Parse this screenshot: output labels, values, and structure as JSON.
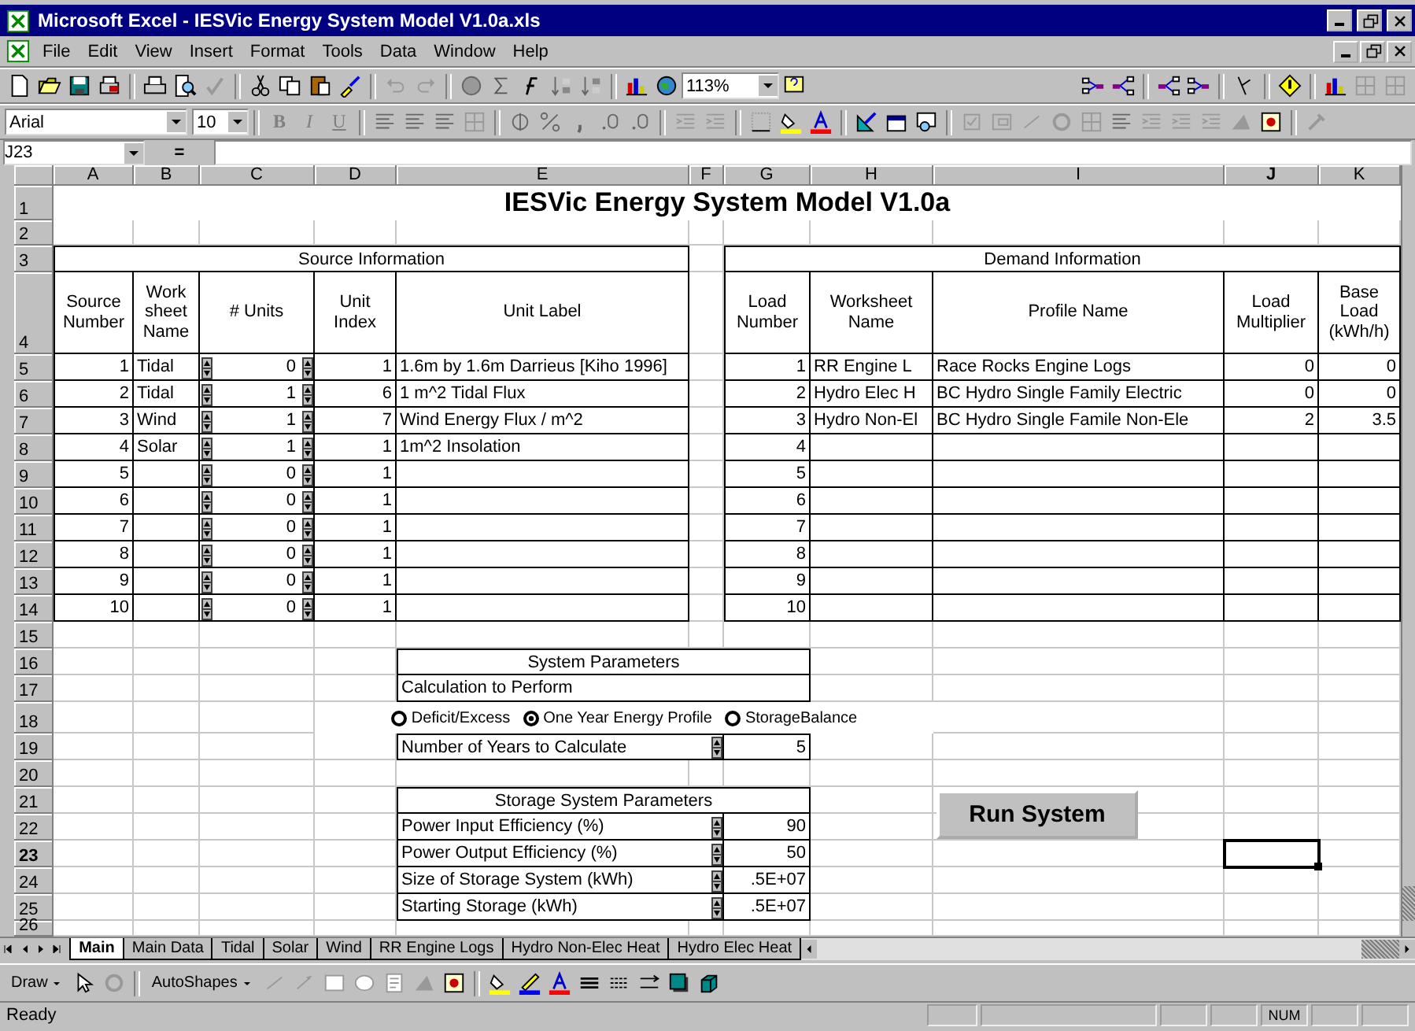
{
  "window": {
    "title": "Microsoft Excel - IESVic Energy System Model V1.0a.xls"
  },
  "menu": [
    "File",
    "Edit",
    "View",
    "Insert",
    "Format",
    "Tools",
    "Data",
    "Window",
    "Help"
  ],
  "toolbar": {
    "zoom": "113%"
  },
  "formatting": {
    "font": "Arial",
    "size": "10",
    "styles": [
      "B",
      "I",
      "U"
    ]
  },
  "formula_bar": {
    "name_box": "J23",
    "equals": "="
  },
  "sheet": {
    "columns": [
      {
        "label": "A",
        "selected": false
      },
      {
        "label": "B",
        "selected": false
      },
      {
        "label": "C",
        "selected": false
      },
      {
        "label": "D",
        "selected": false
      },
      {
        "label": "E",
        "selected": false
      },
      {
        "label": "F",
        "selected": false
      },
      {
        "label": "G",
        "selected": false
      },
      {
        "label": "H",
        "selected": false
      },
      {
        "label": "I",
        "selected": false
      },
      {
        "label": "J",
        "selected": true
      },
      {
        "label": "K",
        "selected": false
      }
    ],
    "rows": [
      {
        "label": "1",
        "selected": false
      },
      {
        "label": "2",
        "selected": false
      },
      {
        "label": "3",
        "selected": false
      },
      {
        "label": "4",
        "selected": false
      },
      {
        "label": "5",
        "selected": false
      },
      {
        "label": "6",
        "selected": false
      },
      {
        "label": "7",
        "selected": false
      },
      {
        "label": "8",
        "selected": false
      },
      {
        "label": "9",
        "selected": false
      },
      {
        "label": "10",
        "selected": false
      },
      {
        "label": "11",
        "selected": false
      },
      {
        "label": "12",
        "selected": false
      },
      {
        "label": "13",
        "selected": false
      },
      {
        "label": "14",
        "selected": false
      },
      {
        "label": "15",
        "selected": false
      },
      {
        "label": "16",
        "selected": false
      },
      {
        "label": "17",
        "selected": false
      },
      {
        "label": "18",
        "selected": false
      },
      {
        "label": "19",
        "selected": false
      },
      {
        "label": "20",
        "selected": false
      },
      {
        "label": "21",
        "selected": false
      },
      {
        "label": "22",
        "selected": false
      },
      {
        "label": "23",
        "selected": true
      },
      {
        "label": "24",
        "selected": false
      },
      {
        "label": "25",
        "selected": false
      },
      {
        "label": "26",
        "selected": false
      }
    ],
    "title": "IESVic Energy System Model V1.0a",
    "source": {
      "heading": "Source Information",
      "columns": [
        "Source Number",
        "Work sheet Name",
        "# Units",
        "Unit Index",
        "Unit Label"
      ],
      "rows": [
        {
          "number": "1",
          "worksheet": "Tidal",
          "units": "0",
          "index": "1",
          "label": "1.6m by 1.6m Darrieus [Kiho 1996]"
        },
        {
          "number": "2",
          "worksheet": "Tidal",
          "units": "1",
          "index": "6",
          "label": "1 m^2 Tidal Flux"
        },
        {
          "number": "3",
          "worksheet": "Wind",
          "units": "1",
          "index": "7",
          "label": "Wind Energy Flux / m^2"
        },
        {
          "number": "4",
          "worksheet": "Solar",
          "units": "1",
          "index": "1",
          "label": "1m^2 Insolation"
        },
        {
          "number": "5",
          "units": "0",
          "index": "1"
        },
        {
          "number": "6",
          "units": "0",
          "index": "1"
        },
        {
          "number": "7",
          "units": "0",
          "index": "1"
        },
        {
          "number": "8",
          "units": "0",
          "index": "1"
        },
        {
          "number": "9",
          "units": "0",
          "index": "1"
        },
        {
          "number": "10",
          "units": "0",
          "index": "1"
        }
      ]
    },
    "demand": {
      "heading": "Demand Information",
      "columns": [
        "Load Number",
        "Worksheet Name",
        "Profile Name",
        "Load Multiplier",
        "Base Load (kWh/h)"
      ],
      "rows": [
        {
          "number": "1",
          "worksheet": "RR Engine L",
          "profile": "Race Rocks Engine Logs",
          "multiplier": "0",
          "base": "0"
        },
        {
          "number": "2",
          "worksheet": "Hydro Elec H",
          "profile": "BC Hydro Single Family Electric",
          "multiplier": "0",
          "base": "0"
        },
        {
          "number": "3",
          "worksheet": "Hydro Non-El",
          "profile": "BC Hydro Single Famile Non-Ele",
          "multiplier": "2",
          "base": "3.5"
        },
        {
          "number": "4"
        },
        {
          "number": "5"
        },
        {
          "number": "6"
        },
        {
          "number": "7"
        },
        {
          "number": "8"
        },
        {
          "number": "9"
        },
        {
          "number": "10"
        }
      ]
    },
    "system_parameters": {
      "heading": "System Parameters",
      "calculation_label": "Calculation to Perform",
      "options": [
        {
          "label": "Deficit/Excess",
          "selected": false
        },
        {
          "label": "One Year Energy Profile",
          "selected": true
        },
        {
          "label": "StorageBalance",
          "selected": false
        }
      ],
      "years_label": "Number of Years to Calculate",
      "years": "5"
    },
    "storage": {
      "heading": "Storage System Parameters",
      "rows": [
        {
          "label": "Power Input Efficiency (%)",
          "value": "90"
        },
        {
          "label": "Power Output Efficiency (%)",
          "value": "50"
        },
        {
          "label": "Size of Storage System (kWh)",
          "value": ".5E+07"
        },
        {
          "label": "Starting Storage (kWh)",
          "value": ".5E+07"
        }
      ]
    },
    "run_button": "Run System"
  },
  "sheet_tabs": [
    {
      "label": "Main",
      "selected": true
    },
    {
      "label": "Main Data",
      "selected": false
    },
    {
      "label": "Tidal",
      "selected": false
    },
    {
      "label": "Solar",
      "selected": false
    },
    {
      "label": "Wind",
      "selected": false
    },
    {
      "label": "RR Engine Logs",
      "selected": false
    },
    {
      "label": "Hydro Non-Elec Heat",
      "selected": false
    },
    {
      "label": "Hydro Elec Heat",
      "selected": false
    }
  ],
  "draw_toolbar": {
    "draw": "Draw",
    "autoshapes": "AutoShapes"
  },
  "status_bar": {
    "status": "Ready",
    "num": "NUM"
  }
}
